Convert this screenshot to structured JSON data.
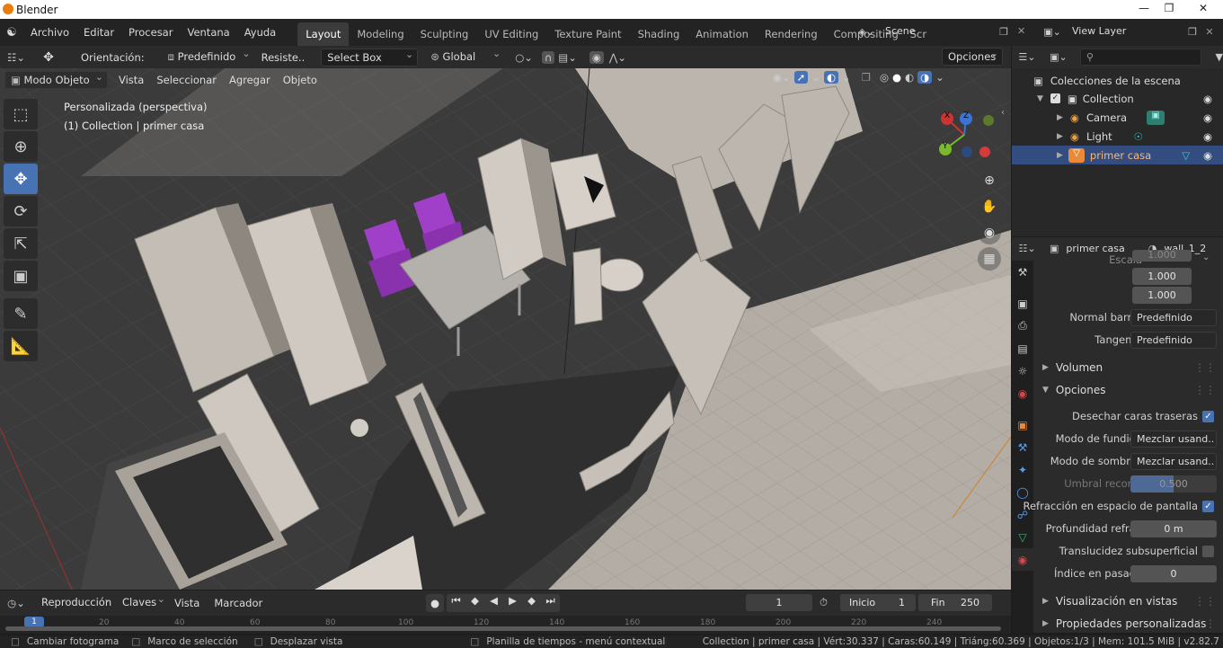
{
  "window": {
    "title": "Blender"
  },
  "menus": [
    "Archivo",
    "Editar",
    "Procesar",
    "Ventana",
    "Ayuda"
  ],
  "workspaces": [
    "Layout",
    "Modeling",
    "Sculpting",
    "UV Editing",
    "Texture Paint",
    "Shading",
    "Animation",
    "Rendering",
    "Compositing",
    "Scr"
  ],
  "scene": {
    "name": "Scene",
    "view_layer": "View Layer"
  },
  "header3d": {
    "orientation_label": "Orientación:",
    "orientation_value": "Predefinido",
    "drag_label": "Resiste..",
    "select_mode": "Select Box",
    "transform_space": "Global",
    "options": "Opciones"
  },
  "header3d_row2": {
    "mode": "Modo Objeto",
    "view": "Vista",
    "select": "Seleccionar",
    "add": "Agregar",
    "object": "Objeto"
  },
  "viewport": {
    "persp_label": "Personalizada (perspectiva)",
    "collection_label": "(1) Collection | primer casa",
    "gizmo": {
      "x": "X",
      "y": "Y",
      "z": "Z"
    }
  },
  "outliner": {
    "root": "Colecciones de la escena",
    "items": [
      {
        "name": "Collection"
      },
      {
        "name": "Camera"
      },
      {
        "name": "Light"
      },
      {
        "name": "primer casa"
      }
    ]
  },
  "properties": {
    "object_name": "primer casa",
    "material_name": "wall_1_2",
    "scale_label": "Escala",
    "scale_values": [
      "1.000",
      "1.000",
      "1.000"
    ],
    "normal_label": "Normal barniz",
    "normal_value": "Predefinido",
    "tangent_label": "Tangente",
    "tangent_value": "Predefinido",
    "panel_volume": "Volumen",
    "panel_options": "Opciones",
    "backface_label": "Desechar caras traseras",
    "blend_label": "Modo de fundido",
    "blend_value": "Mezclar usand..",
    "shadow_label": "Modo de sombras",
    "shadow_value": "Mezclar usand..",
    "clip_label": "Umbral recorte",
    "clip_value": "0.500",
    "refraction_label": "Refracción en espacio de pantalla",
    "refr_depth_label": "Profundidad refra..",
    "refr_depth_value": "0 m",
    "sss_label": "Translucidez subsuperficial",
    "pass_label": "Índice en pasada",
    "pass_value": "0",
    "panel_viewport": "Visualización en vistas",
    "panel_custom": "Propiedades personalizadas"
  },
  "timeline": {
    "playback": "Reproducción",
    "keys": "Claves",
    "view": "Vista",
    "marker": "Marcador",
    "current_frame": "1",
    "start_label": "Inicio",
    "start_value": "1",
    "end_label": "Fin",
    "end_value": "250",
    "ruler": [
      "1",
      "20",
      "40",
      "60",
      "80",
      "100",
      "120",
      "140",
      "160",
      "180",
      "200",
      "220",
      "240"
    ]
  },
  "status": {
    "change_frame": "Cambiar fotograma",
    "box_select": "Marco de selección",
    "pan_view": "Desplazar vista",
    "context_menu": "Planilla de tiempos - menú contextual",
    "stats": "Collection | primer casa | Vért:30.337 | Caras:60.149 | Triáng:60.369 | Objetos:1/3 | Mem: 101.5 MiB | v2.82.7"
  },
  "colors": {
    "accent": "#4772b3",
    "selected_row": "#334d80",
    "chair": "#a040c8"
  }
}
